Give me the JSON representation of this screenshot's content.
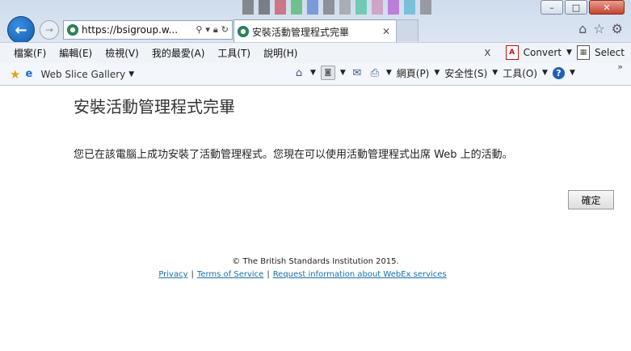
{
  "browser": {
    "address": "https://bsigroup.w...",
    "tab_title": "安裝活動管理程式完畢",
    "window_buttons": {
      "minimize": "–",
      "maximize": "□",
      "close": "✕"
    }
  },
  "menubar": {
    "items": [
      "檔案(F)",
      "編輯(E)",
      "檢視(V)",
      "我的最愛(A)",
      "工具(T)",
      "說明(H)"
    ],
    "dismiss": "x",
    "convert_label": "Convert",
    "select_label": "Select"
  },
  "commandbar": {
    "web_slice_label": "Web Slice Gallery",
    "page_menu": "網頁(P)",
    "safety_menu": "安全性(S)",
    "tools_menu": "工具(O)"
  },
  "page": {
    "heading": "安裝活動管理程式完畢",
    "message": "您已在該電腦上成功安裝了活動管理程式。您現在可以使用活動管理程式出席 Web 上的活動。",
    "ok_button": "確定",
    "copyright": "© The British Standards Institution 2015.",
    "links": [
      "Privacy",
      "Terms of Service",
      "Request information about WebEx services"
    ],
    "link_separator": "|"
  },
  "icons": [
    "back-arrow-icon",
    "forward-arrow-icon",
    "search-icon",
    "lock-icon",
    "refresh-icon",
    "close-icon",
    "home-icon",
    "star-icon",
    "gear-icon",
    "pdf-icon",
    "rss-icon",
    "mail-icon",
    "print-icon",
    "help-icon",
    "favorites-star-icon",
    "ie-icon"
  ]
}
